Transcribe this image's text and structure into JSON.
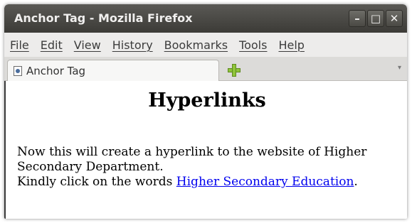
{
  "window": {
    "title": "Anchor Tag - Mozilla Firefox",
    "controls": {
      "minimize": "–",
      "maximize": "□",
      "close": "✕"
    }
  },
  "menu": {
    "items": [
      "File",
      "Edit",
      "View",
      "History",
      "Bookmarks",
      "Tools",
      "Help"
    ]
  },
  "tabs": {
    "active_label": "Anchor Tag",
    "new_tab_icon": "plus-icon",
    "list_icon": "▾"
  },
  "page": {
    "heading": "Hyperlinks",
    "line1": "Now this will create a hyperlink to the website of Higher Secondary Department.",
    "line2_prefix": "Kindly click on the words ",
    "link_text": "Higher Secondary Education",
    "line2_suffix": "."
  },
  "colors": {
    "titlebar": "#3c3b37",
    "link": "#0000ee",
    "new_tab_plus": "#8fc43a"
  }
}
